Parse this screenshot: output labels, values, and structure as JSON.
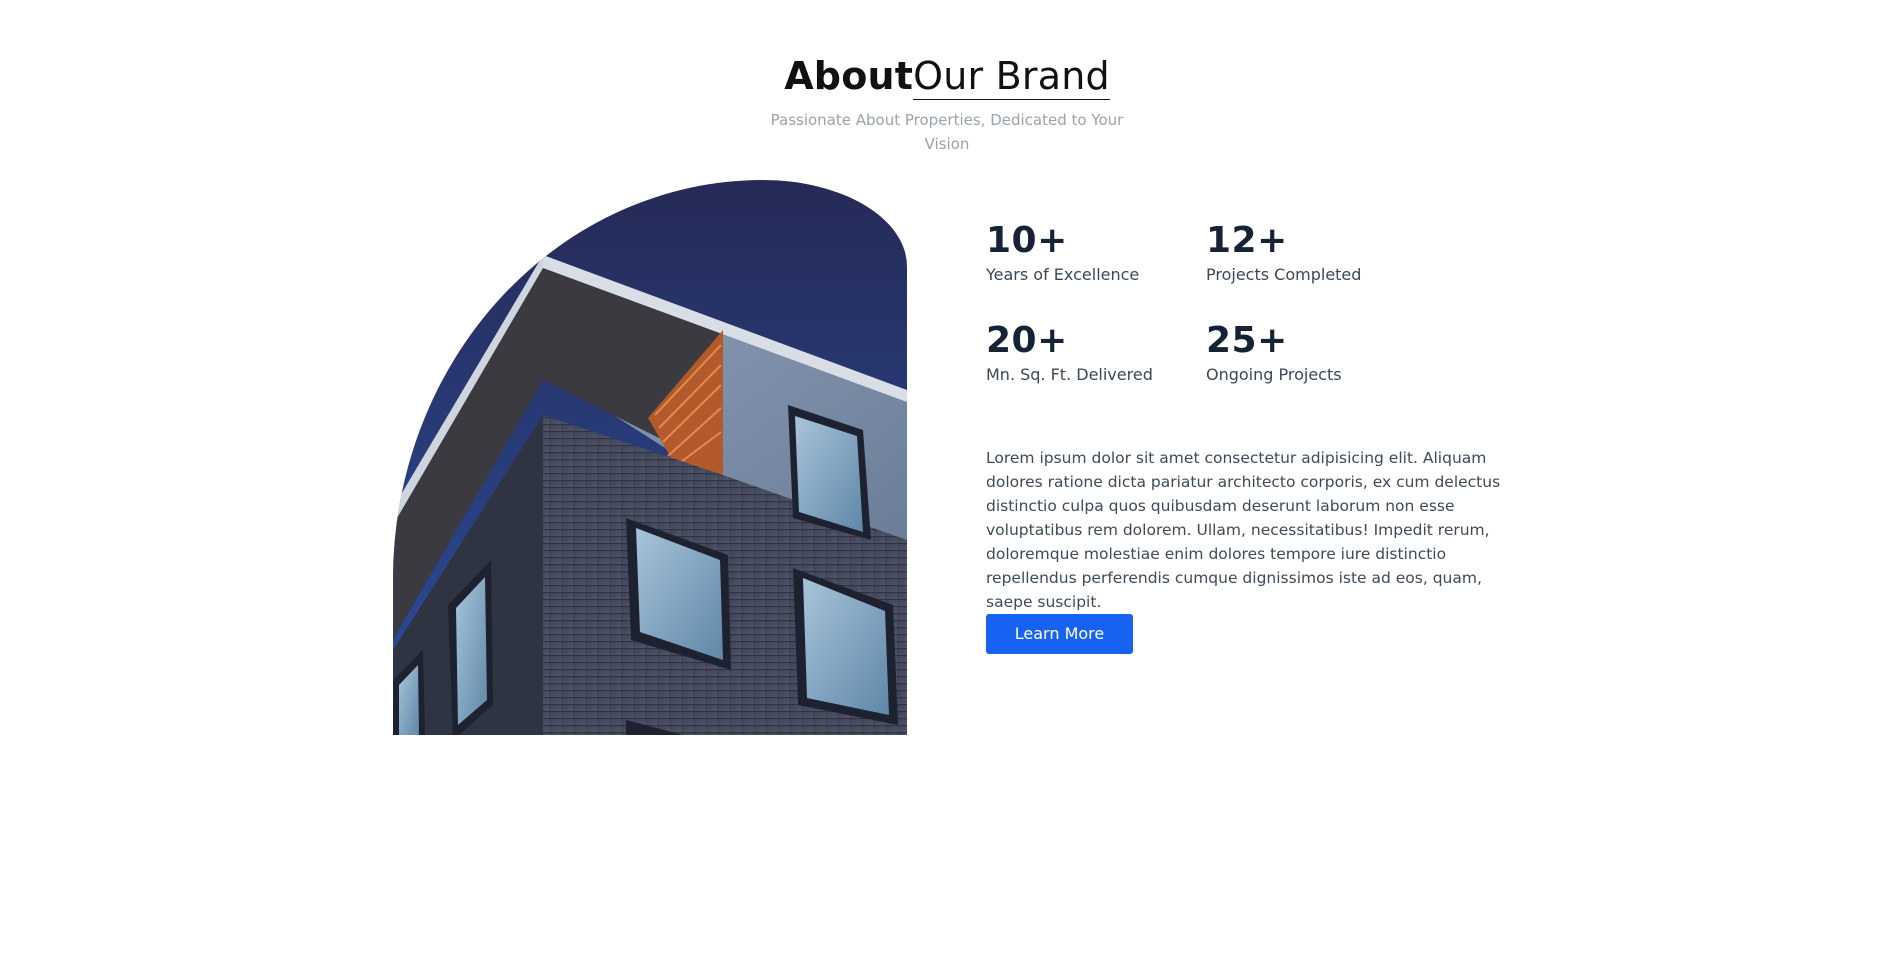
{
  "header": {
    "title_strong": "About",
    "title_light": "Our Brand",
    "subtitle": "Passionate About Properties, Dedicated to Your Vision"
  },
  "stats": [
    {
      "number": "10+",
      "label": "Years of Excellence"
    },
    {
      "number": "12+",
      "label": "Projects Completed"
    },
    {
      "number": "20+",
      "label": "Mn. Sq. Ft. Delivered"
    },
    {
      "number": "25+",
      "label": "Ongoing Projects"
    }
  ],
  "description": "Lorem ipsum dolor sit amet consectetur adipisicing elit. Aliquam dolores ratione dicta pariatur architecto corporis, ex cum delectus distinctio culpa quos quibusdam deserunt laborum non esse voluptatibus rem dolorem. Ullam, necessitatibus! Impedit rerum, doloremque molestiae enim dolores tempore iure distinctio repellendus perferendis cumque dignissimos iste ad eos, quam, saepe suscipit.",
  "cta": {
    "label": "Learn More"
  },
  "colors": {
    "accent": "#1762f1",
    "heading": "#162235",
    "muted": "#9aa2ac",
    "sky_top": "#262a56",
    "sky_bottom": "#2a4e9f"
  }
}
